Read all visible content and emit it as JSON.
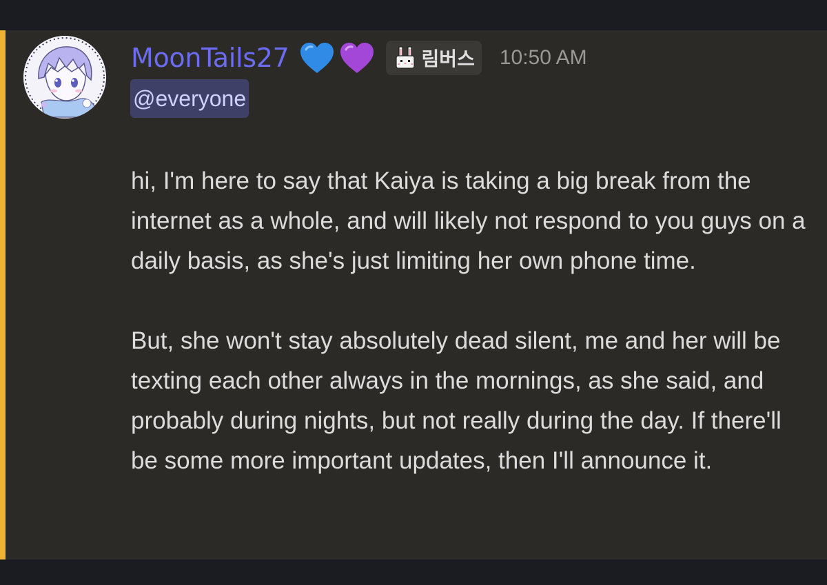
{
  "message": {
    "author": "MoonTails27",
    "author_color": "#6b6cf2",
    "author_badges": [
      "blue-heart-icon",
      "purple-heart-icon"
    ],
    "role_tag": {
      "icon": "bunny-icon",
      "label": "림버스"
    },
    "timestamp": "10:50 AM",
    "mention": "@everyone",
    "paragraph_1": "hi, I'm here to say that Kaiya is taking a big break from the internet as a whole, and will likely not respond to you guys on a daily basis, as she's just limiting her own phone time.",
    "paragraph_2": "But, she won't stay absolutely dead silent, me and her will be texting each other always in the mornings, as she said, and probably during nights, but not really during the day. If there'll be some more important updates, then I'll announce it."
  },
  "colors": {
    "mention_stripe": "#f0b232",
    "mention_bg": "#3f4068",
    "message_bg": "#2c2a26"
  }
}
